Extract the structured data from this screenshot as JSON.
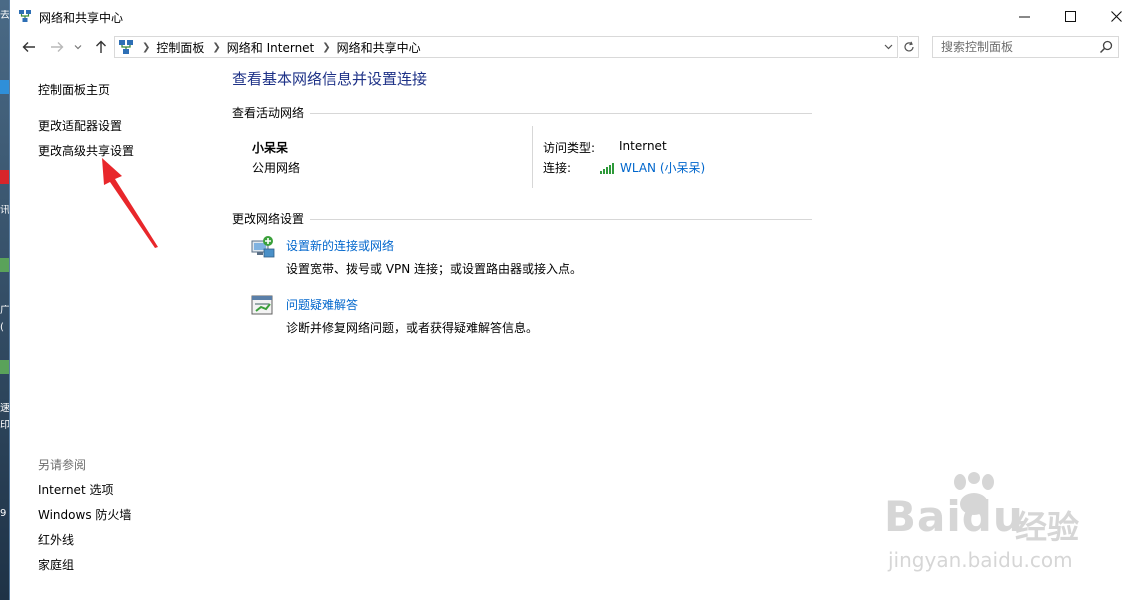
{
  "window": {
    "title": "网络和共享中心"
  },
  "desktop": {
    "fragments": [
      "去",
      "讯",
      "广",
      "(",
      "速",
      "印",
      "9"
    ]
  },
  "navigation": {
    "breadcrumbs": [
      "控制面板",
      "网络和 Internet",
      "网络和共享中心"
    ],
    "search_placeholder": "搜索控制面板"
  },
  "sidebar": {
    "home_link": "控制面板主页",
    "links": [
      "更改适配器设置",
      "更改高级共享设置"
    ],
    "see_also_header": "另请参阅",
    "see_also": [
      "Internet 选项",
      "Windows 防火墙",
      "红外线",
      "家庭组"
    ]
  },
  "main": {
    "title": "查看基本网络信息并设置连接",
    "active_networks_header": "查看活动网络",
    "network": {
      "name": "小呆呆",
      "category": "公用网络",
      "access_type_label": "访问类型:",
      "access_type_value": "Internet",
      "connection_label": "连接:",
      "connection_value": "WLAN (小呆呆)"
    },
    "change_settings_header": "更改网络设置",
    "tasks": [
      {
        "link": "设置新的连接或网络",
        "description": "设置宽带、拨号或 VPN 连接；或设置路由器或接入点。",
        "icon": "network-setup-icon"
      },
      {
        "link": "问题疑难解答",
        "description": "诊断并修复网络问题，或者获得疑难解答信息。",
        "icon": "troubleshoot-icon"
      }
    ]
  },
  "watermark": {
    "brand": "Bai",
    "brand_suffix": "du",
    "cn": "经验",
    "url": "jingyan.baidu.com"
  },
  "colors": {
    "link_blue": "#0066cc",
    "title_blue": "#1e3287",
    "annotation_red": "#e8272b",
    "signal_green": "#2e9a3a"
  }
}
